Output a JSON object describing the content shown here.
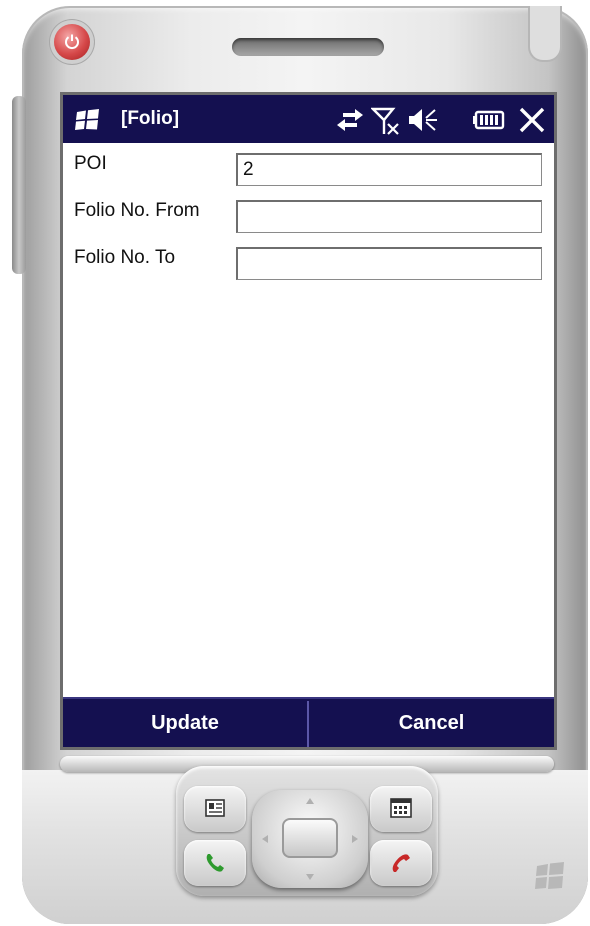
{
  "window": {
    "title": "[Folio]"
  },
  "status_icons": [
    "sync-icon",
    "no-signal-icon",
    "speaker-icon",
    "battery-icon"
  ],
  "form": {
    "fields": [
      {
        "label": "POI",
        "value": "2"
      },
      {
        "label": "Folio No. From",
        "value": ""
      },
      {
        "label": "Folio No. To",
        "value": ""
      }
    ]
  },
  "softkeys": {
    "left": "Update",
    "right": "Cancel"
  },
  "colors": {
    "titlebar": "#141050",
    "softbar": "#141050",
    "background": "#ffffff"
  }
}
